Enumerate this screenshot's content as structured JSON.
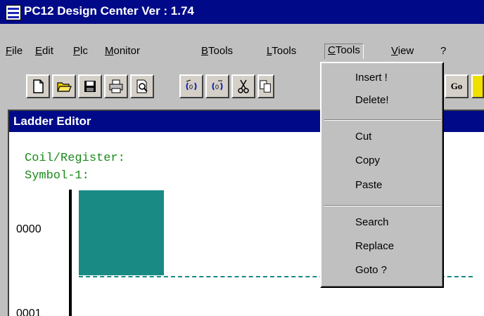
{
  "window": {
    "title": "PC12 Design Center Ver : 1.74"
  },
  "menubar": {
    "items": [
      {
        "label": "File",
        "ul": "F",
        "rest": "ile"
      },
      {
        "label": "Edit",
        "ul": "E",
        "rest": "dit"
      },
      {
        "label": "Plc",
        "ul": "P",
        "rest": "lc"
      },
      {
        "label": "Monitor",
        "ul": "M",
        "rest": "onitor"
      },
      {
        "label": "BTools",
        "ul": "B",
        "rest": "Tools"
      },
      {
        "label": "LTools",
        "ul": "L",
        "rest": "Tools"
      },
      {
        "label": "CTools",
        "ul": "C",
        "rest": "Tools"
      },
      {
        "label": "View",
        "ul": "V",
        "rest": "iew"
      },
      {
        "label": "?",
        "ul": "",
        "rest": "?"
      }
    ]
  },
  "toolbar": {
    "buttons": [
      "new-file-icon",
      "open-folder-icon",
      "save-disk-icon",
      "print-icon",
      "print-preview-icon",
      "coil-in-icon",
      "coil-out-icon",
      "cut-icon",
      "copy-icon",
      "go-icon"
    ],
    "go_label": "Go"
  },
  "dropdown": {
    "items": [
      "Insert !",
      "Delete!",
      "Cut",
      "Copy",
      "Paste",
      "Search",
      "Replace",
      "Goto ?"
    ]
  },
  "editor": {
    "title": "Ladder Editor",
    "coil_label": "Coil/Register:",
    "symbol_label": "Symbol-1:",
    "addresses": [
      "0000",
      "0001"
    ],
    "cursor_color": "#1a8a85"
  }
}
